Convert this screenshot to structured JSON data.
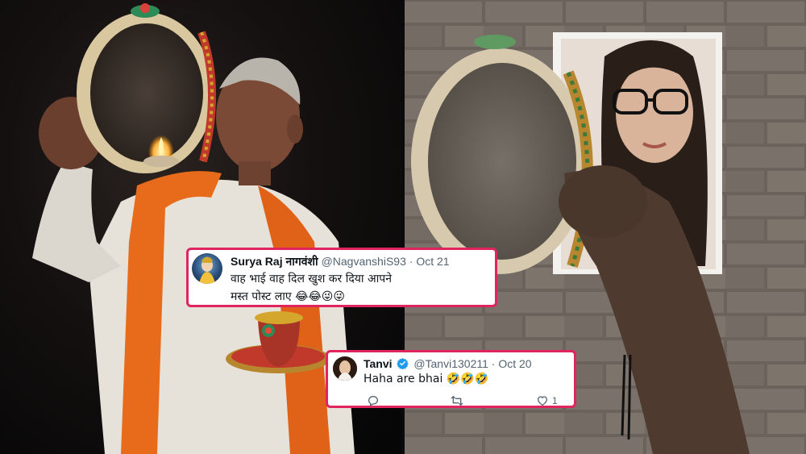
{
  "tweets": [
    {
      "name": "Surya Raj नागवंशी",
      "handle": "@NagvanshiS93",
      "sep": "·",
      "date": "Oct 21",
      "text_line1": "वाह भाई वाह दिल खुश कर दिया आपने",
      "text_line2": "मस्त पोस्ट लाए 😂😂😜😜"
    },
    {
      "name": "Tanvi",
      "handle": "@Tanvi130211",
      "sep": "·",
      "date": "Oct 20",
      "text_line1": "Haha are bhai 🤣🤣🤣",
      "like_count": "1",
      "verified": true
    }
  ],
  "colors": {
    "tweet_border": "#e0245e",
    "verified_badge": "#1d9bf0",
    "secondary_text": "#536471"
  },
  "icons": [
    "verified-badge-icon",
    "reply-icon",
    "retweet-icon",
    "like-icon"
  ]
}
